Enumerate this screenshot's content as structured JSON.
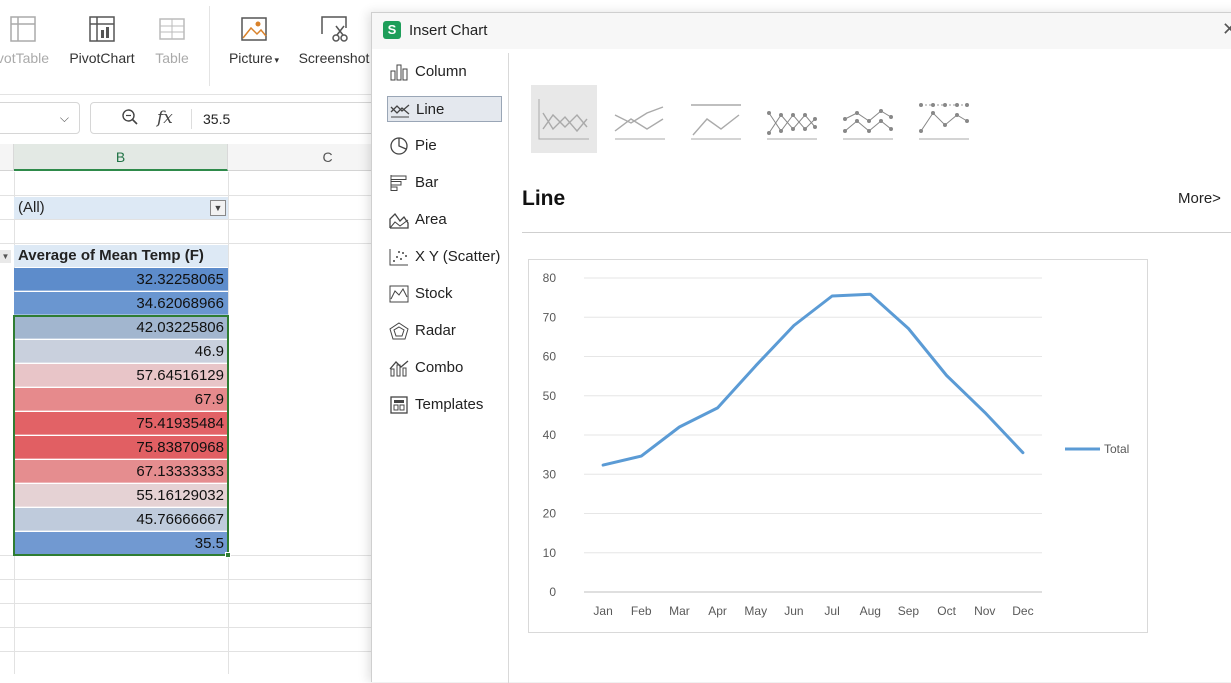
{
  "ribbon": {
    "buttons": [
      {
        "label": "votTable",
        "disabled": true
      },
      {
        "label": "PivotChart",
        "disabled": false
      },
      {
        "label": "Table",
        "disabled": true
      },
      {
        "label": "Picture",
        "has_dropdown": true
      },
      {
        "label": "Screenshot"
      }
    ]
  },
  "formula_bar": {
    "value": "35.5"
  },
  "columns": [
    "B",
    "C"
  ],
  "pivot": {
    "filter_value": "(All)",
    "header": "Average of Mean Temp (F)",
    "values": [
      {
        "text": "32.32258065",
        "color": "#5d8ccb"
      },
      {
        "text": "34.62068966",
        "color": "#6a96d0"
      },
      {
        "text": "42.03225806",
        "color": "#a2b6cf"
      },
      {
        "text": "46.9",
        "color": "#c9d0dd"
      },
      {
        "text": "57.64516129",
        "color": "#e8c5c8"
      },
      {
        "text": "67.9",
        "color": "#e68a8c"
      },
      {
        "text": "75.41935484",
        "color": "#e26266"
      },
      {
        "text": "75.83870968",
        "color": "#e15f63"
      },
      {
        "text": "67.13333333",
        "color": "#e58d8f"
      },
      {
        "text": "55.16129032",
        "color": "#e5d2d4"
      },
      {
        "text": "45.76666667",
        "color": "#bfcbdc"
      },
      {
        "text": "35.5",
        "color": "#7199d1"
      }
    ]
  },
  "dialog": {
    "title": "Insert Chart",
    "categories": [
      {
        "label": "Column",
        "icon": "column-chart-icon"
      },
      {
        "label": "Line",
        "icon": "line-chart-icon",
        "selected": true
      },
      {
        "label": "Pie",
        "icon": "pie-chart-icon"
      },
      {
        "label": "Bar",
        "icon": "bar-chart-icon"
      },
      {
        "label": "Area",
        "icon": "area-chart-icon"
      },
      {
        "label": "X Y (Scatter)",
        "icon": "scatter-chart-icon"
      },
      {
        "label": "Stock",
        "icon": "stock-chart-icon"
      },
      {
        "label": "Radar",
        "icon": "radar-chart-icon"
      },
      {
        "label": "Combo",
        "icon": "combo-chart-icon"
      },
      {
        "label": "Templates",
        "icon": "templates-icon"
      }
    ],
    "chart_name": "Line",
    "more_label": "More>",
    "accent": "#1e9e5a"
  },
  "chart_data": {
    "type": "line",
    "categories": [
      "Jan",
      "Feb",
      "Mar",
      "Apr",
      "May",
      "Jun",
      "Jul",
      "Aug",
      "Sep",
      "Oct",
      "Nov",
      "Dec"
    ],
    "series": [
      {
        "name": "Total",
        "color": "#5b9bd5",
        "values": [
          32.32258065,
          34.62068966,
          42.03225806,
          46.9,
          57.64516129,
          67.9,
          75.41935484,
          75.83870968,
          67.13333333,
          55.16129032,
          45.76666667,
          35.5
        ]
      }
    ],
    "yticks": [
      0,
      10,
      20,
      30,
      40,
      50,
      60,
      70,
      80
    ],
    "ylim": [
      0,
      80
    ],
    "grid": true,
    "legend": "right"
  }
}
